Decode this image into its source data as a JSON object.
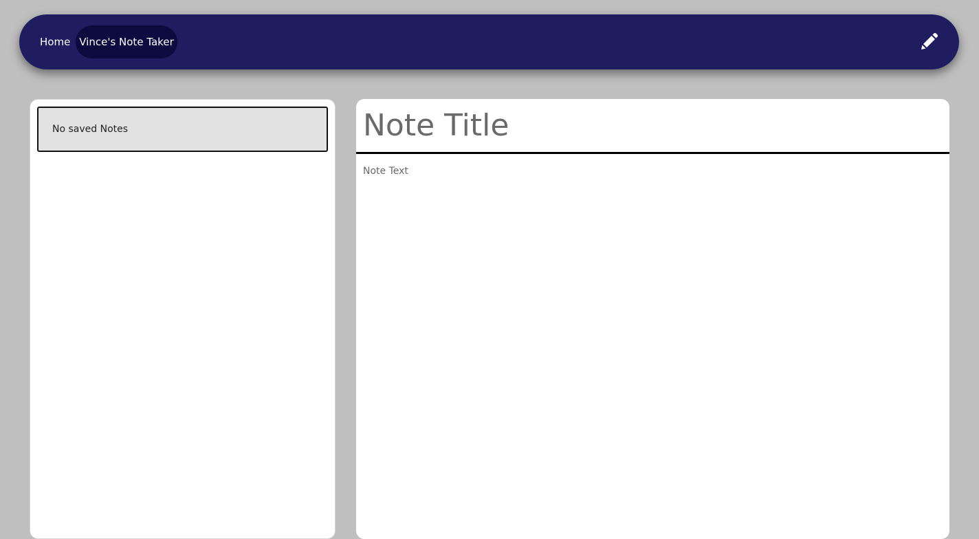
{
  "navbar": {
    "home_label": "Home",
    "brand_label": "Vince's Note Taker",
    "new_note_icon": "pencil-icon",
    "background_color": "#1f1d5f",
    "brand_pill_color": "#0c0a3e"
  },
  "sidebar": {
    "empty_message": "No saved Notes"
  },
  "editor": {
    "title_placeholder": "Note Title",
    "title_value": "",
    "text_placeholder": "Note Text",
    "text_value": ""
  },
  "colors": {
    "page_background": "#bfbfbf",
    "panel_background": "#ffffff"
  }
}
